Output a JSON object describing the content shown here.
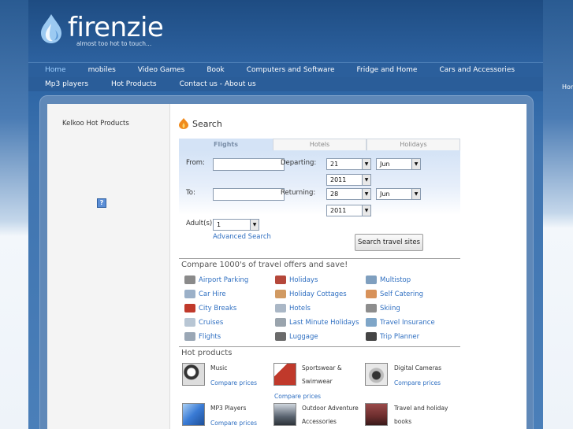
{
  "site": {
    "logo_text": "firenzie",
    "tagline": "almost too hot to touch..."
  },
  "offscreen_label": "Hom",
  "nav": {
    "row1": [
      {
        "label": "Home",
        "active": true
      },
      {
        "label": "mobiles",
        "active": false
      },
      {
        "label": "Video Games",
        "active": false
      },
      {
        "label": "Book",
        "active": false
      },
      {
        "label": "Computers and Software",
        "active": false
      },
      {
        "label": "Fridge and Home",
        "active": false
      },
      {
        "label": "Cars and Accessories",
        "active": false
      }
    ],
    "row2": [
      {
        "label": "Mp3 players",
        "active": false
      },
      {
        "label": "Hot Products",
        "active": false
      },
      {
        "label": "Contact us - About us",
        "active": false
      }
    ]
  },
  "sidebar": {
    "title": "Kelkoo Hot Products",
    "help_badge": "?"
  },
  "search": {
    "title": "Search",
    "tabs": [
      {
        "label": "Flights",
        "active": true
      },
      {
        "label": "Hotels",
        "active": false
      },
      {
        "label": "Holidays",
        "active": false
      }
    ],
    "from_label": "From:",
    "to_label": "To:",
    "departing_label": "Departing:",
    "returning_label": "Returning:",
    "adults_label": "Adult(s):",
    "from_value": "",
    "to_value": "",
    "departing": {
      "day": "21",
      "month": "Jun",
      "year": "2011"
    },
    "returning": {
      "day": "28",
      "month": "Jun",
      "year": "2011"
    },
    "adults": "1",
    "advanced_link": "Advanced Search",
    "submit_label": "Search travel sites"
  },
  "compare": {
    "title": "Compare 1000's of travel offers and save!",
    "links": [
      {
        "label": "Airport Parking",
        "icon": "airport-parking-icon",
        "color": "#8a8a8a"
      },
      {
        "label": "Holidays",
        "icon": "holidays-icon",
        "color": "#b5473a"
      },
      {
        "label": "Multistop",
        "icon": "multistop-icon",
        "color": "#7f9fbf"
      },
      {
        "label": "Car Hire",
        "icon": "car-icon",
        "color": "#9bb0c8"
      },
      {
        "label": "Holiday Cottages",
        "icon": "cottage-icon",
        "color": "#d19a62"
      },
      {
        "label": "Self Catering",
        "icon": "self-catering-icon",
        "color": "#d8925a"
      },
      {
        "label": "City Breaks",
        "icon": "city-bus-icon",
        "color": "#c0392b"
      },
      {
        "label": "Hotels",
        "icon": "hotel-icon",
        "color": "#aab7c6"
      },
      {
        "label": "Skiing",
        "icon": "skiing-icon",
        "color": "#8d8d8d"
      },
      {
        "label": "Cruises",
        "icon": "cruise-icon",
        "color": "#b8c6d4"
      },
      {
        "label": "Last Minute Holidays",
        "icon": "last-minute-icon",
        "color": "#9aa4ad"
      },
      {
        "label": "Travel Insurance",
        "icon": "umbrella-icon",
        "color": "#7fa6c8"
      },
      {
        "label": "Flights",
        "icon": "plane-icon",
        "color": "#9aa7b5"
      },
      {
        "label": "Luggage",
        "icon": "luggage-icon",
        "color": "#6b6b6b"
      },
      {
        "label": "Trip Planner",
        "icon": "trip-planner-icon",
        "color": "#444444"
      }
    ]
  },
  "hot": {
    "title": "Hot products",
    "items": [
      {
        "name_lines": [
          "Music"
        ],
        "link": "Compare prices",
        "icon": "headphones-icon",
        "color": "#333333"
      },
      {
        "name_lines": [
          "Sportswear &",
          "Swimwear"
        ],
        "link": "Compare prices",
        "icon": "sportswear-icon",
        "color": "#c0392b"
      },
      {
        "name_lines": [
          "Digital Cameras"
        ],
        "link": "Compare prices",
        "icon": "camera-icon",
        "color": "#777777"
      },
      {
        "name_lines": [
          "MP3 Players"
        ],
        "link": "Compare prices",
        "icon": "mp3-player-icon",
        "color": "#3a7bd5"
      },
      {
        "name_lines": [
          "Outdoor Adventure",
          "Accessories"
        ],
        "link": "",
        "icon": "outdoor-icon",
        "color": "#5a6470"
      },
      {
        "name_lines": [
          "Travel and holiday",
          "books"
        ],
        "link": "",
        "icon": "books-icon",
        "color": "#6b2d2d"
      }
    ]
  },
  "colors": {
    "header_blue": "#2b5f9c",
    "link_blue": "#2f6fc1",
    "tab_active_bg": "#d4e3f6"
  }
}
